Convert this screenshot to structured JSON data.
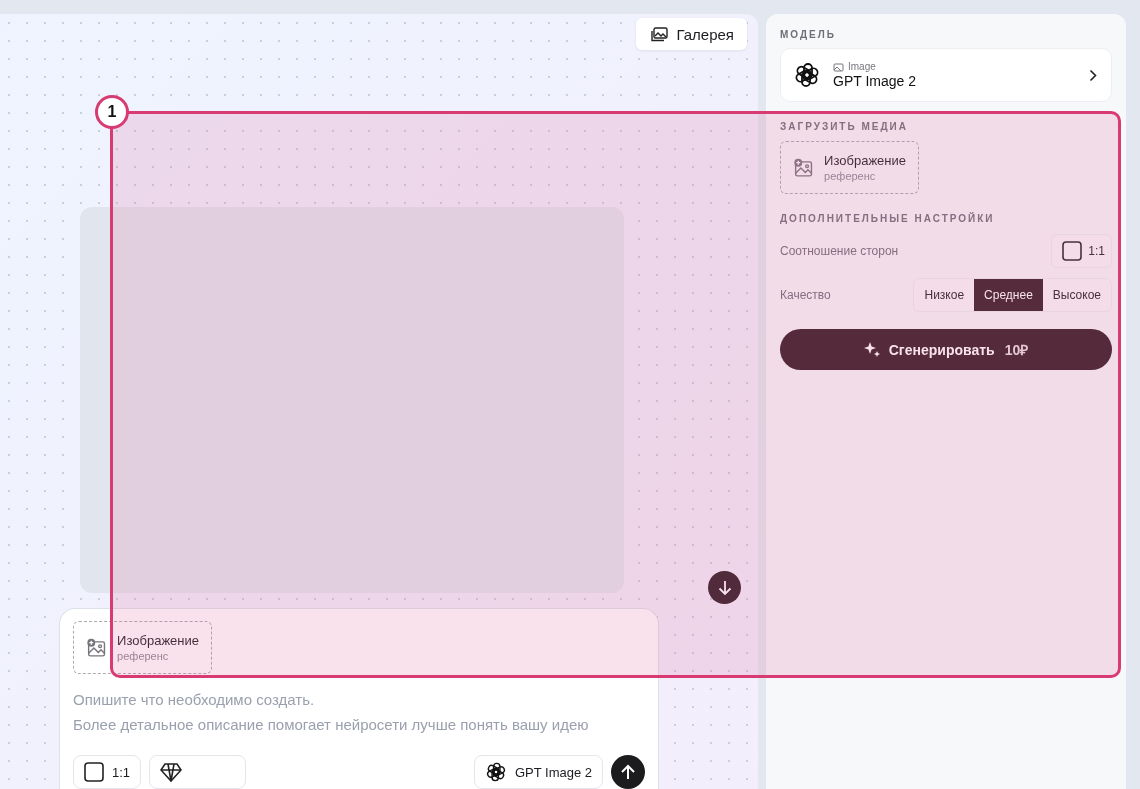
{
  "gallery_button": {
    "label": "Галерея"
  },
  "composer": {
    "upload": {
      "title": "Изображение",
      "subtitle": "референс"
    },
    "prompt": {
      "placeholder": "Опишите что необходимо создать.\nБолее детальное описание помогает нейросети лучше понять вашу идею"
    },
    "aspect": {
      "value": "1:1"
    },
    "model": {
      "name": "GPT Image 2"
    }
  },
  "sidebar": {
    "model_section": {
      "title": "МОДЕЛЬ",
      "category": "Image",
      "name": "GPT Image 2"
    },
    "media_section": {
      "title": "ЗАГРУЗИТЬ МЕДИА",
      "title_2": "Изображение",
      "subtitle": "референс"
    },
    "settings_section": {
      "title": "ДОПОЛНИТЕЛЬНЫЕ НАСТРОЙКИ",
      "aspect": {
        "label": "Соотношение сторон",
        "value": "1:1"
      },
      "quality": {
        "label": "Качество",
        "options": [
          {
            "label": "Низкое",
            "selected": false
          },
          {
            "label": "Среднее",
            "selected": true
          },
          {
            "label": "Высокое",
            "selected": false
          }
        ]
      }
    },
    "generate_button": {
      "label": "Сгенерировать",
      "price": "10₽"
    }
  },
  "annotation": {
    "label": "1"
  }
}
